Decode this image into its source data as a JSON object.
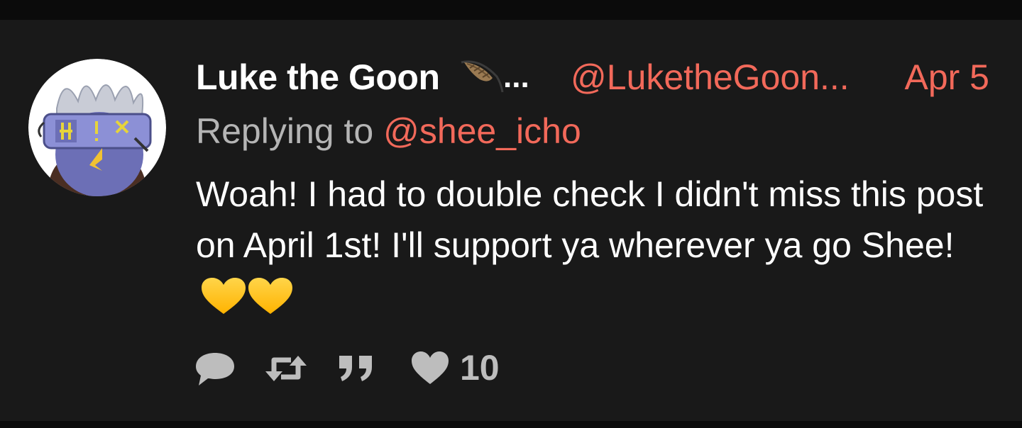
{
  "tweet": {
    "display_name": "Luke the Goon",
    "name_ellipsis": "...",
    "handle": "@LuketheGoon...",
    "date": "Apr 5",
    "replying_prefix": "Replying to",
    "replying_handle": "@shee_icho",
    "text": "Woah! I had to double check I didn't miss this post on April 1st! I'll support ya wherever ya go Shee!",
    "like_count": "10"
  },
  "icons": {
    "avatar": "avatar-image",
    "name_emoji": "feather-icon",
    "text_emoji": "yellow-heart-icon",
    "reply": "reply-icon",
    "retweet": "retweet-icon",
    "quote": "quote-icon",
    "like": "heart-icon"
  },
  "colors": {
    "background": "#191919",
    "accent": "#f2695a",
    "muted": "#b5b5b5",
    "action": "#bdbdbd",
    "heart_emoji": "#ffc107"
  }
}
